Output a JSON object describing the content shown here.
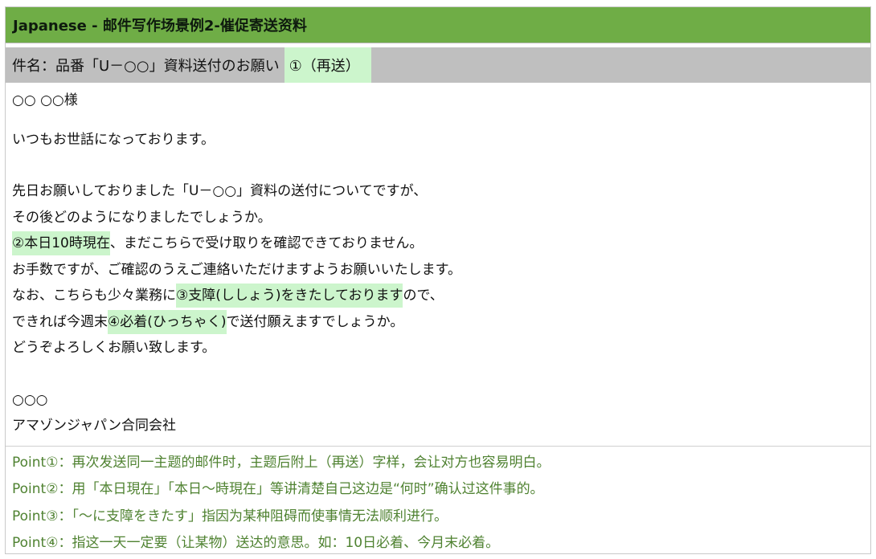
{
  "header": {
    "title": "Japanese - 邮件写作场景例2-催促寄送资料"
  },
  "subject": {
    "text": "件名：品番「U－○○」資料送付のお願い",
    "highlight": "①（再送）"
  },
  "email": {
    "greeting": "○○ ○○様",
    "opening": "いつもお世話になっております。",
    "line1": "先日お願いしておりました「U－○○」資料の送付についてですが、",
    "line2": "その後どのようになりましたでしょうか。",
    "line3_hl": "②本日10時現在",
    "line3_rest": "、まだこちらで受け取りを確認できておりません。",
    "line4": "お手数ですが、ご確認のうえご連絡いただけますようお願いいたします。",
    "line5_pre": "なお、こちらも少々業務に",
    "line5_hl": "③支障(ししょう)をきたしております",
    "line5_post": "ので、",
    "line6_pre": "できれば今週末",
    "line6_hl": "④必着(ひっちゃく)",
    "line6_post": "で送付願えますでしょうか。",
    "line7": "どうぞよろしくお願い致します。",
    "sign_name": "○○○",
    "sign_company": "アマゾンジャパン合同会社"
  },
  "points": [
    "Point①：再次发送同一主题的邮件时，主题后附上（再送）字样，会让对方也容易明白。",
    "Point②：用「本日現在」「本日～時現在」等讲清楚自己这边是“何时”确认过这件事的。",
    "Point③：「～に支障をきたす」指因为某种阻碍而使事情无法顺利进行。",
    "Point④：指这一天一定要（让某物）送达的意思。如：10日必着、今月末必着。"
  ],
  "colors": {
    "title_bg": "#6fad46",
    "subject_bg": "#bfbfbf",
    "highlight": "#ccf5cc",
    "point_text": "#4f8231"
  }
}
